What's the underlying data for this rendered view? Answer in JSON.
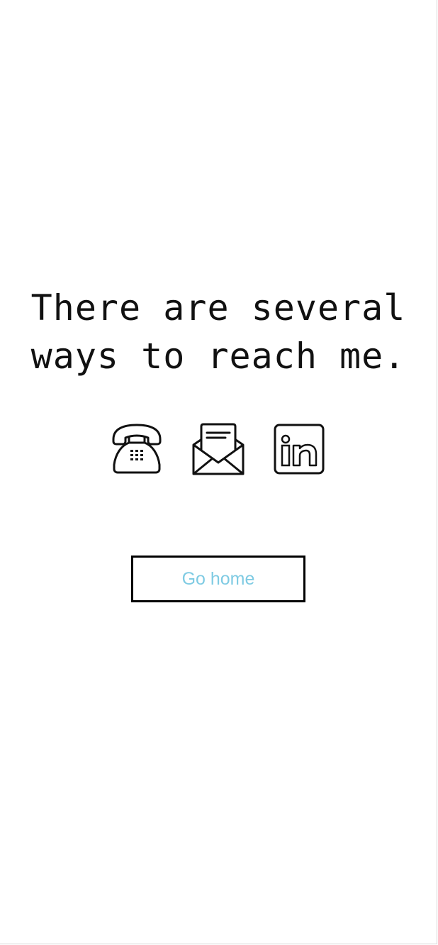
{
  "headline": {
    "line1": "There are several",
    "line2": "ways to reach me."
  },
  "contact_icons": [
    {
      "name": "phone-icon"
    },
    {
      "name": "envelope-icon"
    },
    {
      "name": "linkedin-icon"
    }
  ],
  "home_button": {
    "label": "Go home"
  },
  "colors": {
    "background": "#ffffff",
    "text": "#111111",
    "button_border": "#000000",
    "button_text": "#7fcbe3"
  }
}
